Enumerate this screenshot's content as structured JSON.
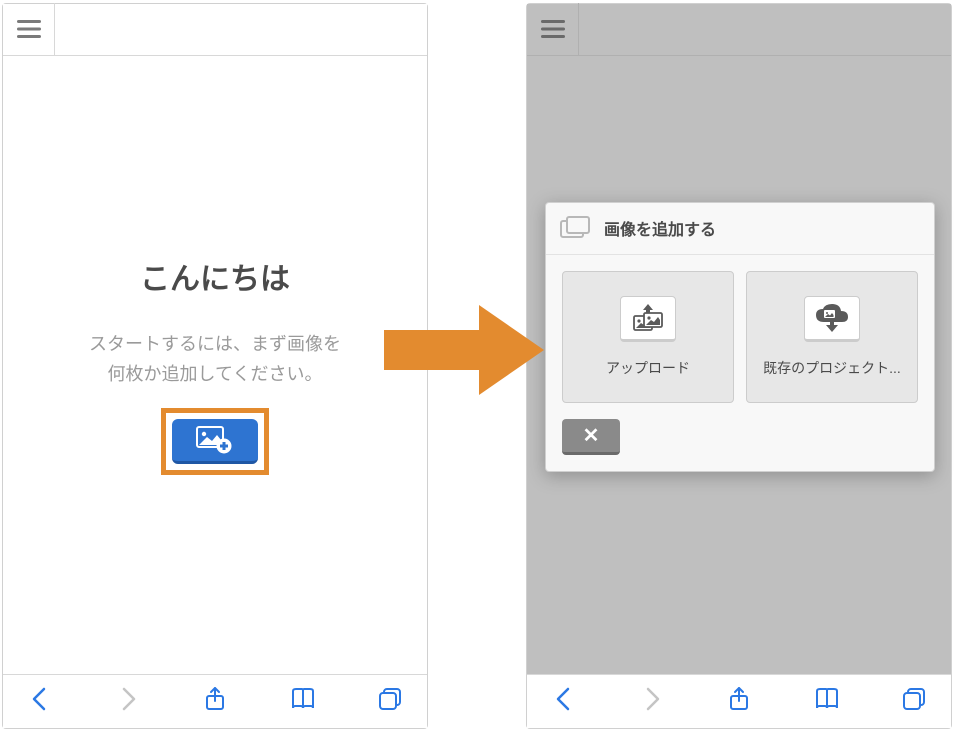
{
  "left": {
    "title": "こんにちは",
    "subtitle_line1": "スタートするには、まず画像を",
    "subtitle_line2": "何枚か追加してください。"
  },
  "arrow": {
    "color": "#e38b2f"
  },
  "dialog": {
    "title": "画像を追加する",
    "options": [
      {
        "label": "アップロード"
      },
      {
        "label": "既存のプロジェクト..."
      }
    ],
    "close": "✕"
  },
  "colors": {
    "accent": "#2b78e4",
    "highlight": "#e38b2f",
    "button": "#2e74d1"
  }
}
